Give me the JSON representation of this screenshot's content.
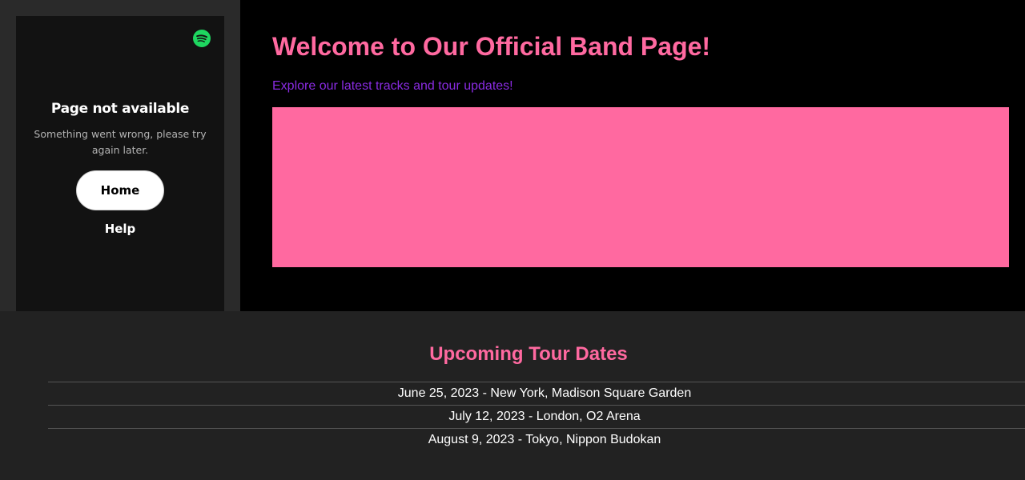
{
  "embed": {
    "logo_icon": "spotify-logo-icon",
    "title": "Page not available",
    "message": "Something went wrong, please try again later.",
    "home_label": "Home",
    "help_label": "Help"
  },
  "main": {
    "heading": "Welcome to Our Official Band Page!",
    "subheading": "Explore our latest tracks and tour updates!"
  },
  "tour": {
    "heading": "Upcoming Tour Dates",
    "dates": [
      "June 25, 2023 - New York, Madison Square Garden",
      "July 12, 2023 - London, O2 Arena",
      "August 9, 2023 - Tokyo, Nippon Budokan"
    ]
  },
  "colors": {
    "accent_pink": "#ff69a0",
    "accent_purple": "#8a2be2",
    "spotify_green": "#1ed760",
    "embed_bg": "#121212",
    "page_bg": "#000000",
    "section_bg": "#222222"
  }
}
